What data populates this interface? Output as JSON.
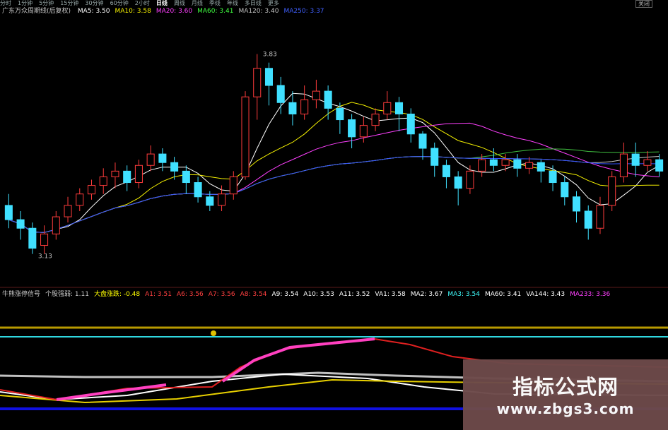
{
  "toolbar": {
    "tabs": [
      "分时",
      "1分钟",
      "5分钟",
      "15分钟",
      "30分钟",
      "60分钟",
      "2小时",
      "日线",
      "周线",
      "月线",
      "季线",
      "年线",
      "多日线",
      "更多"
    ],
    "active_tab": "日线",
    "close_label": "关闭"
  },
  "main_legend": {
    "title": "广东万众周期线(后复权)",
    "items": [
      {
        "label": "MA5: 3.50",
        "color": "#ffffff"
      },
      {
        "label": "MA10: 3.58",
        "color": "#f4f000"
      },
      {
        "label": "MA20: 3.60",
        "color": "#ff40ff"
      },
      {
        "label": "MA60: 3.41",
        "color": "#40ff40"
      },
      {
        "label": "MA120: 3.40",
        "color": "#c0c0c0"
      },
      {
        "label": "MA250: 3.37",
        "color": "#4060ff"
      }
    ]
  },
  "ind_legend": {
    "items": [
      {
        "label": "牛熊涨停信号",
        "color": "#c8c8c8"
      },
      {
        "label": "个股强弱: 1.11",
        "color": "#c8c8c8"
      },
      {
        "label": "大盘涨跌: -0.48",
        "color": "#ffff00"
      },
      {
        "label": "A1: 3.51",
        "color": "#ff4040"
      },
      {
        "label": "A6: 3.56",
        "color": "#ff4040"
      },
      {
        "label": "A7: 3.56",
        "color": "#ff4040"
      },
      {
        "label": "A8: 3.54",
        "color": "#ff4040"
      },
      {
        "label": "A9: 3.54",
        "color": "#ffffff"
      },
      {
        "label": "A10: 3.53",
        "color": "#ffffff"
      },
      {
        "label": "A11: 3.52",
        "color": "#ffffff"
      },
      {
        "label": "VA1: 3.58",
        "color": "#ffffff"
      },
      {
        "label": "MA2: 3.67",
        "color": "#ffffff"
      },
      {
        "label": "MA3: 3.54",
        "color": "#40ffff"
      },
      {
        "label": "MA60: 3.41",
        "color": "#ffffff"
      },
      {
        "label": "VA144: 3.43",
        "color": "#ffffff"
      },
      {
        "label": "MA233: 3.36",
        "color": "#ff40ff"
      }
    ]
  },
  "chart_data": {
    "type": "candlestick",
    "price_high_label": "3.83",
    "price_low_label": "3.13",
    "ylim": [
      3.05,
      3.95
    ],
    "candles": [
      [
        3.3,
        3.25,
        3.34,
        3.22
      ],
      [
        3.25,
        3.22,
        3.28,
        3.18
      ],
      [
        3.22,
        3.15,
        3.24,
        3.13
      ],
      [
        3.16,
        3.2,
        3.23,
        3.13
      ],
      [
        3.2,
        3.26,
        3.28,
        3.18
      ],
      [
        3.26,
        3.3,
        3.33,
        3.24
      ],
      [
        3.3,
        3.34,
        3.36,
        3.28
      ],
      [
        3.34,
        3.37,
        3.39,
        3.32
      ],
      [
        3.37,
        3.4,
        3.43,
        3.34
      ],
      [
        3.4,
        3.42,
        3.45,
        3.36
      ],
      [
        3.42,
        3.38,
        3.44,
        3.35
      ],
      [
        3.38,
        3.44,
        3.46,
        3.36
      ],
      [
        3.44,
        3.48,
        3.51,
        3.42
      ],
      [
        3.48,
        3.45,
        3.5,
        3.42
      ],
      [
        3.45,
        3.42,
        3.47,
        3.39
      ],
      [
        3.42,
        3.38,
        3.44,
        3.34
      ],
      [
        3.38,
        3.33,
        3.4,
        3.31
      ],
      [
        3.33,
        3.3,
        3.35,
        3.28
      ],
      [
        3.3,
        3.34,
        3.37,
        3.28
      ],
      [
        3.34,
        3.4,
        3.42,
        3.32
      ],
      [
        3.4,
        3.68,
        3.7,
        3.39
      ],
      [
        3.68,
        3.78,
        3.83,
        3.6
      ],
      [
        3.78,
        3.72,
        3.8,
        3.65
      ],
      [
        3.72,
        3.66,
        3.75,
        3.62
      ],
      [
        3.66,
        3.62,
        3.7,
        3.58
      ],
      [
        3.62,
        3.67,
        3.72,
        3.6
      ],
      [
        3.67,
        3.7,
        3.74,
        3.64
      ],
      [
        3.7,
        3.64,
        3.72,
        3.6
      ],
      [
        3.64,
        3.6,
        3.66,
        3.55
      ],
      [
        3.6,
        3.54,
        3.62,
        3.5
      ],
      [
        3.54,
        3.58,
        3.61,
        3.52
      ],
      [
        3.58,
        3.62,
        3.64,
        3.56
      ],
      [
        3.62,
        3.66,
        3.7,
        3.6
      ],
      [
        3.66,
        3.62,
        3.68,
        3.56
      ],
      [
        3.62,
        3.55,
        3.64,
        3.52
      ],
      [
        3.55,
        3.5,
        3.56,
        3.46
      ],
      [
        3.5,
        3.44,
        3.52,
        3.4
      ],
      [
        3.44,
        3.4,
        3.46,
        3.36
      ],
      [
        3.4,
        3.36,
        3.42,
        3.3
      ],
      [
        3.36,
        3.42,
        3.44,
        3.34
      ],
      [
        3.42,
        3.46,
        3.48,
        3.4
      ],
      [
        3.46,
        3.44,
        3.5,
        3.42
      ],
      [
        3.44,
        3.46,
        3.48,
        3.42
      ],
      [
        3.46,
        3.43,
        3.48,
        3.4
      ],
      [
        3.43,
        3.45,
        3.47,
        3.41
      ],
      [
        3.45,
        3.42,
        3.46,
        3.38
      ],
      [
        3.42,
        3.38,
        3.44,
        3.35
      ],
      [
        3.38,
        3.33,
        3.4,
        3.3
      ],
      [
        3.33,
        3.28,
        3.35,
        3.24
      ],
      [
        3.28,
        3.22,
        3.3,
        3.18
      ],
      [
        3.22,
        3.3,
        3.33,
        3.2
      ],
      [
        3.3,
        3.4,
        3.42,
        3.28
      ],
      [
        3.4,
        3.48,
        3.52,
        3.38
      ],
      [
        3.48,
        3.44,
        3.52,
        3.4
      ],
      [
        3.44,
        3.46,
        3.49,
        3.42
      ],
      [
        3.46,
        3.42,
        3.48,
        3.4
      ]
    ]
  }
}
